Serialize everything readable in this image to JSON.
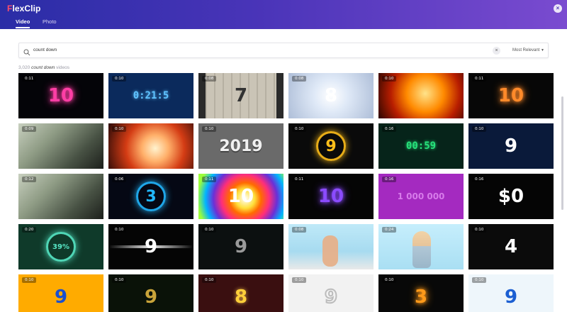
{
  "app": {
    "logo": "FlexClip"
  },
  "tabs": [
    {
      "label": "Video",
      "active": true
    },
    {
      "label": "Photo",
      "active": false
    }
  ],
  "search": {
    "value": "count down",
    "sort": "Most Relevant"
  },
  "results": {
    "count": "3,020",
    "query": "count down",
    "suffix": "videos"
  },
  "thumbnails": [
    {
      "duration": "0:11",
      "overlay": "10",
      "bg": "#040408",
      "fg": "#ff3ea5",
      "style": "neon"
    },
    {
      "duration": "0:10",
      "overlay": "0:21:5",
      "bg": "#0b2a5c",
      "fg": "#5fc3ff",
      "style": "digital"
    },
    {
      "duration": "0:08",
      "overlay": "7",
      "bg": "#bcb6a8",
      "fg": "#333333",
      "style": "film"
    },
    {
      "duration": "0:08",
      "overlay": "8",
      "bg": "#c8d6ec",
      "fg": "#ffffff",
      "style": "ghost"
    },
    {
      "duration": "0:10",
      "overlay": "",
      "bg": "#d65a00",
      "fg": "#ffd24a",
      "style": "fire"
    },
    {
      "duration": "0:11",
      "overlay": "10",
      "bg": "#070707",
      "fg": "#ff8a2a",
      "style": "neon"
    },
    {
      "duration": "0:09",
      "overlay": "",
      "bg": "#6f7a6d",
      "fg": "#b6c3a6",
      "style": "money"
    },
    {
      "duration": "0:10",
      "overlay": "",
      "bg": "#c7421c",
      "fg": "#ffe1a8",
      "style": "burst"
    },
    {
      "duration": "0:10",
      "overlay": "2019",
      "bg": "#6a6a6a",
      "fg": "#f0f0f0",
      "style": "block"
    },
    {
      "duration": "0:10",
      "overlay": "9",
      "bg": "#0a0a0a",
      "fg": "#ffbf1a",
      "style": "ring"
    },
    {
      "duration": "0:16",
      "overlay": "00:59",
      "bg": "#06241a",
      "fg": "#26e07a",
      "style": "digital"
    },
    {
      "duration": "0:10",
      "overlay": "9",
      "bg": "#0a1a3a",
      "fg": "#ffffff",
      "style": "plain"
    },
    {
      "duration": "0:12",
      "overlay": "",
      "bg": "#8c8a7c",
      "fg": "#c7c2a5",
      "style": "money"
    },
    {
      "duration": "0:06",
      "overlay": "3",
      "bg": "#050814",
      "fg": "#22b8ff",
      "style": "ring"
    },
    {
      "duration": "0:11",
      "overlay": "10",
      "bg": "#d6263a",
      "fg": "#ffffff",
      "style": "rainbow"
    },
    {
      "duration": "0:11",
      "overlay": "10",
      "bg": "#050505",
      "fg": "#8b4bff",
      "style": "neon"
    },
    {
      "duration": "0:16",
      "overlay": "1 000 000",
      "bg": "#a42ac0",
      "fg": "#d77bea",
      "style": "plain"
    },
    {
      "duration": "0:16",
      "overlay": "$0",
      "bg": "#050505",
      "fg": "#ffffff",
      "style": "plain"
    },
    {
      "duration": "0:20",
      "overlay": "39%",
      "bg": "#0f3a2a",
      "fg": "#57e7c6",
      "style": "ring"
    },
    {
      "duration": "0:10",
      "overlay": "9",
      "bg": "#050505",
      "fg": "#ffffff",
      "style": "streak"
    },
    {
      "duration": "0:10",
      "overlay": "9",
      "bg": "#0c1010",
      "fg": "#9a9a9a",
      "style": "plain"
    },
    {
      "duration": "0:08",
      "overlay": "",
      "bg": "#a9dff3",
      "fg": "#e6b08a",
      "style": "hand"
    },
    {
      "duration": "0:24",
      "overlay": "",
      "bg": "#b8e2f3",
      "fg": "#f1d3a7",
      "style": "person"
    },
    {
      "duration": "0:10",
      "overlay": "4",
      "bg": "#0b0b0b",
      "fg": "#ffffff",
      "style": "plain"
    },
    {
      "duration": "0:10",
      "overlay": "9",
      "bg": "#ffab00",
      "fg": "#1a4fd0",
      "style": "plain"
    },
    {
      "duration": "0:10",
      "overlay": "9",
      "bg": "#0a1208",
      "fg": "#c9a43a",
      "style": "plain"
    },
    {
      "duration": "0:10",
      "overlay": "8",
      "bg": "#3a0f10",
      "fg": "#ffcf3a",
      "style": "stage"
    },
    {
      "duration": "0:10",
      "overlay": "9",
      "bg": "#f2f2f2",
      "fg": "#bcbcbc",
      "style": "outline"
    },
    {
      "duration": "0:10",
      "overlay": "3",
      "bg": "#080808",
      "fg": "#ff9a1a",
      "style": "glow"
    },
    {
      "duration": "0:10",
      "overlay": "9",
      "bg": "#eef6fb",
      "fg": "#1c5fd2",
      "style": "plain"
    }
  ]
}
